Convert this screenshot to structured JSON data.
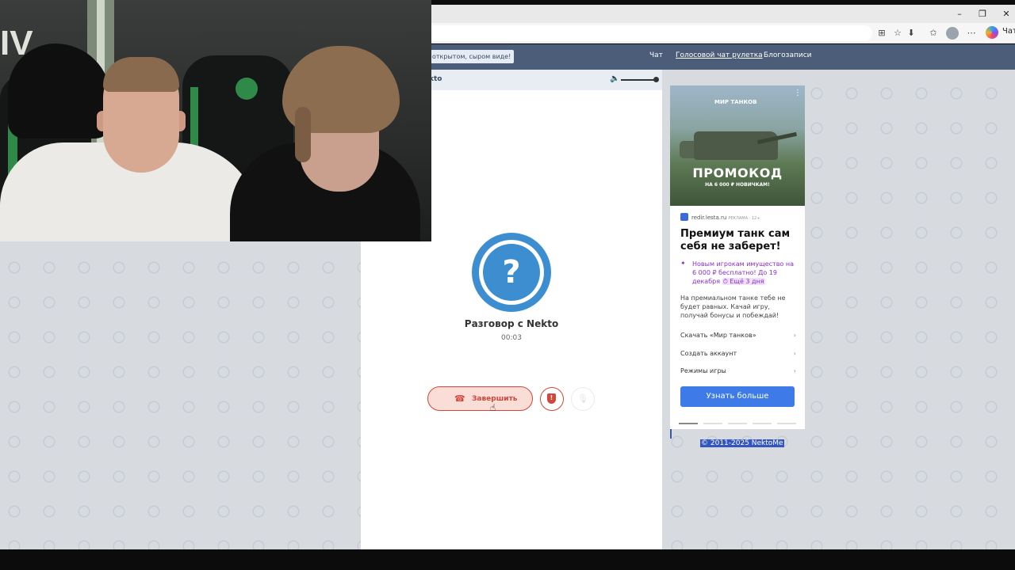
{
  "browser": {
    "window_controls": [
      "–",
      "❐",
      "✕"
    ],
    "copilot_label": "Чат",
    "toolbar_icons": [
      "apps-icon",
      "star-icon",
      "extensions-icon",
      "favorites-icon",
      "profile-icon",
      "more-icon"
    ]
  },
  "site": {
    "nav_pill": "открытом, сыром виде!",
    "nav_links": [
      "Чат",
      "Голосовой чат рулетка",
      "Блогозаписи"
    ],
    "chat_header_title": "kto",
    "conversation": {
      "title": "Разговор с Nekto",
      "timer": "00:03",
      "avatar_symbol": "?",
      "end_button_label": "Завершить"
    },
    "copyright": "© 2011-2025 NektoMe"
  },
  "ad": {
    "brand": "МИР ТАНКОВ",
    "promo_title": "ПРОМОКОД",
    "promo_sub": "НА 6 000 ₽ НОВИЧКАМ!",
    "domain": "redir.lesta.ru",
    "tag": "РЕКЛАМА · 12+",
    "headline": "Премиум танк сам себя не заберет!",
    "offer": "Новым игрокам имущество на 6 000 ₽ бесплатно! До 19 декабря",
    "offer_days": "Ещё 3 дня",
    "description": "На премиальном танке тебе не будет равных. Качай игру, получай бонусы и побеждай!",
    "links": [
      "Скачать «Мир танков»",
      "Создать аккаунт",
      "Режимы игры"
    ],
    "cta": "Узнать больше"
  },
  "colors": {
    "navbar": "#4b5d79",
    "end_button": "#d2473c",
    "avatar": "#3d8ed0",
    "cta": "#3f7be8"
  }
}
